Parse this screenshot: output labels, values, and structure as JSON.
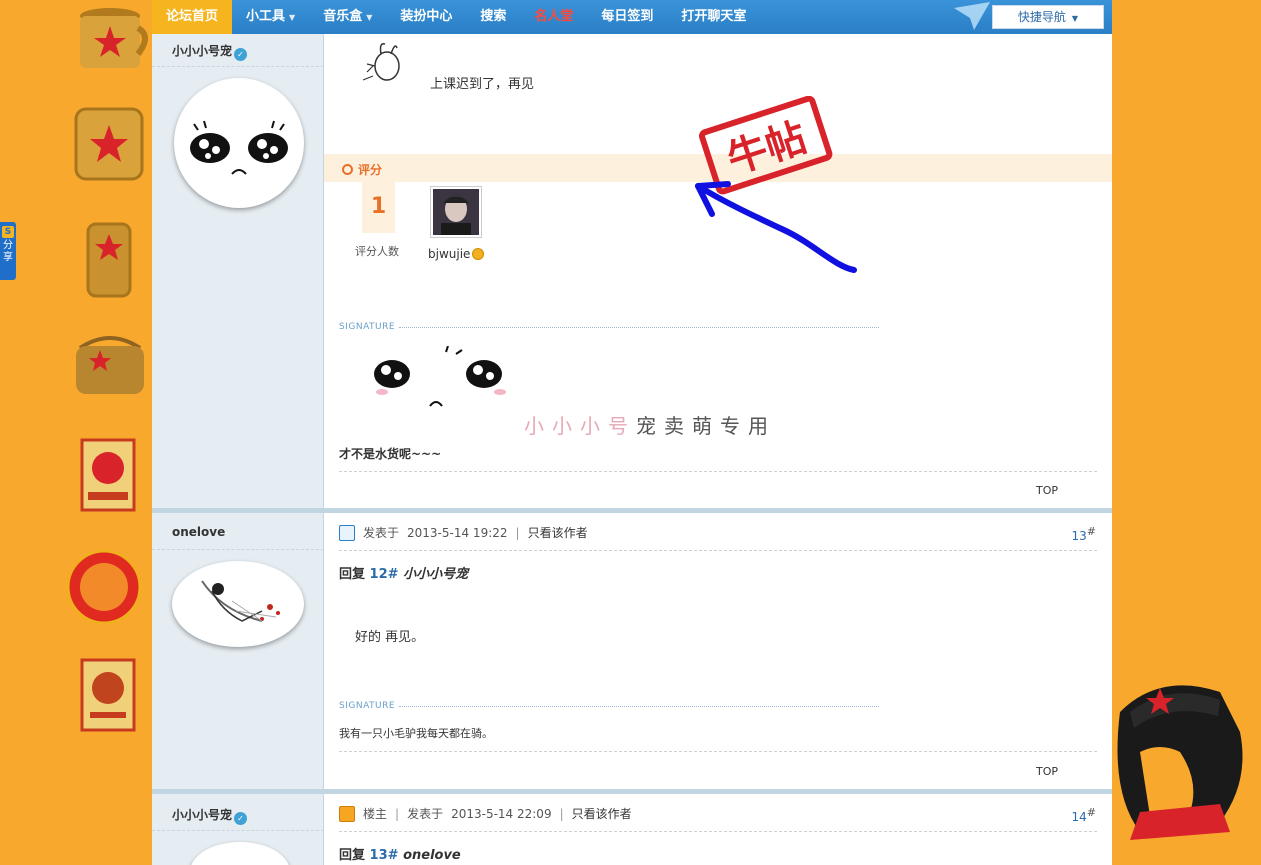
{
  "nav": {
    "items": [
      {
        "label": "论坛首页",
        "style": "home"
      },
      {
        "label": "小工具",
        "dropdown": true
      },
      {
        "label": "音乐盒",
        "dropdown": true
      },
      {
        "label": "装扮中心"
      },
      {
        "label": "搜索"
      },
      {
        "label": "名人堂",
        "style": "red"
      },
      {
        "label": "每日签到"
      },
      {
        "label": "打开聊天室"
      }
    ],
    "quick_nav_label": "快捷导航"
  },
  "share": {
    "label_1": "分",
    "label_2": "享"
  },
  "post12": {
    "author": "小小小号宠",
    "body_text": "上课迟到了，再见",
    "rating": {
      "title": "评分",
      "count": "1",
      "count_label": "评分人数",
      "rater_name": "bjwujie"
    },
    "stamp_text": "牛帖",
    "signature_label": "SIGNATURE",
    "signature_handwriting_light": "小小小号",
    "signature_handwriting_dark": "宠卖萌专用",
    "signature_text": "才不是水货呢~~~",
    "top_link": "TOP"
  },
  "post13": {
    "author": "onelove",
    "posted_prefix": "发表于",
    "posted_time": "2013-5-14 19:22",
    "only_author": "只看该作者",
    "floor": "13",
    "floor_mark": "#",
    "reply_prefix": "回复",
    "reply_floor": "12#",
    "reply_to": "小小小号宠",
    "body_text": "好的 再见。",
    "signature_label": "SIGNATURE",
    "signature_text": "我有一只小毛驴我每天都在骑。",
    "top_link": "TOP"
  },
  "post14": {
    "author": "小小小号宠",
    "host_label": "楼主",
    "posted_prefix": "发表于",
    "posted_time": "2013-5-14 22:09",
    "only_author": "只看该作者",
    "floor": "14",
    "floor_mark": "#",
    "reply_prefix": "回复",
    "reply_floor": "13#",
    "reply_to": "onelove"
  },
  "colors": {
    "background": "#f9a82e",
    "nav_blue": "#2a7fc6",
    "nav_home": "#f6b51e",
    "accent_link": "#2b6ba8",
    "rating_orange": "#e8712a",
    "stamp_red": "#d8232a",
    "arrow_blue": "#1010e0"
  }
}
